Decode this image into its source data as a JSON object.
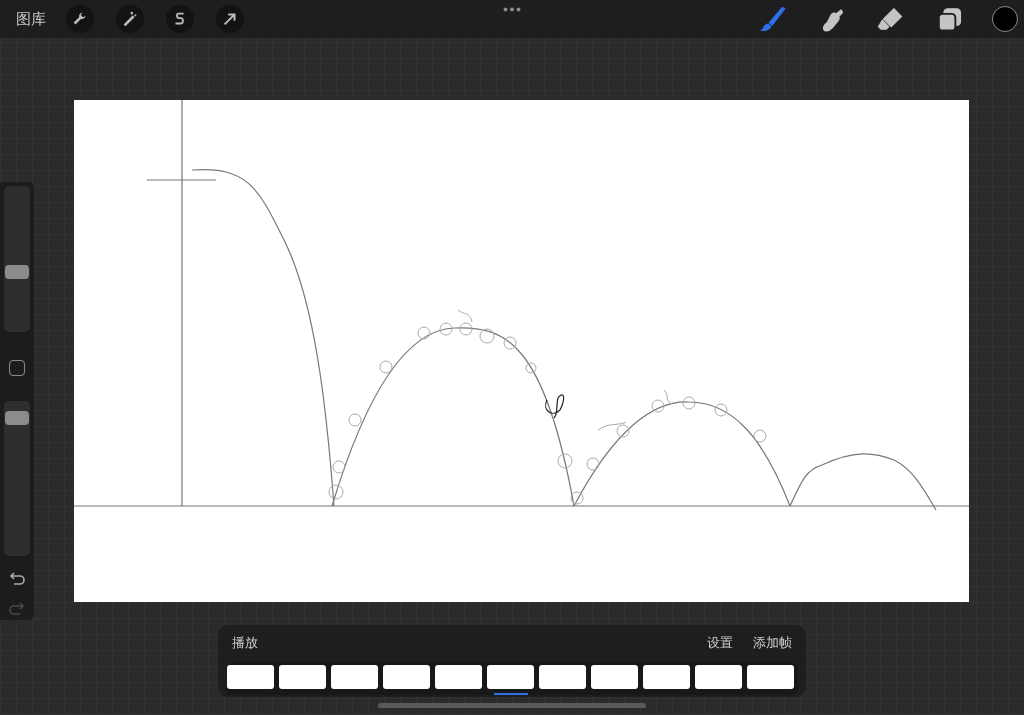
{
  "top_bar": {
    "gallery": "图库",
    "actions": [
      {
        "kind": "wrench"
      },
      {
        "kind": "wand"
      },
      {
        "kind": "selection"
      },
      {
        "kind": "transform"
      }
    ],
    "paint_tools": [
      {
        "kind": "brush",
        "selected": true
      },
      {
        "kind": "smudge",
        "selected": false
      },
      {
        "kind": "eraser",
        "selected": false
      },
      {
        "kind": "layers",
        "selected": false
      }
    ]
  },
  "sidebar": {
    "sliders": [
      {
        "level": 0.4
      },
      {
        "level": 0.93
      }
    ],
    "history": [
      {
        "kind": "undo",
        "disabled": false
      },
      {
        "kind": "redo",
        "disabled": true
      }
    ]
  },
  "timeline": {
    "play": "播放",
    "settings": "设置",
    "add_frame": "添加帧",
    "frames": [
      {
        "selected": false
      },
      {
        "selected": false
      },
      {
        "selected": false
      },
      {
        "selected": false
      },
      {
        "selected": false
      },
      {
        "selected": true
      },
      {
        "selected": false
      },
      {
        "selected": false
      },
      {
        "selected": false
      },
      {
        "selected": false
      },
      {
        "selected": false
      }
    ]
  }
}
